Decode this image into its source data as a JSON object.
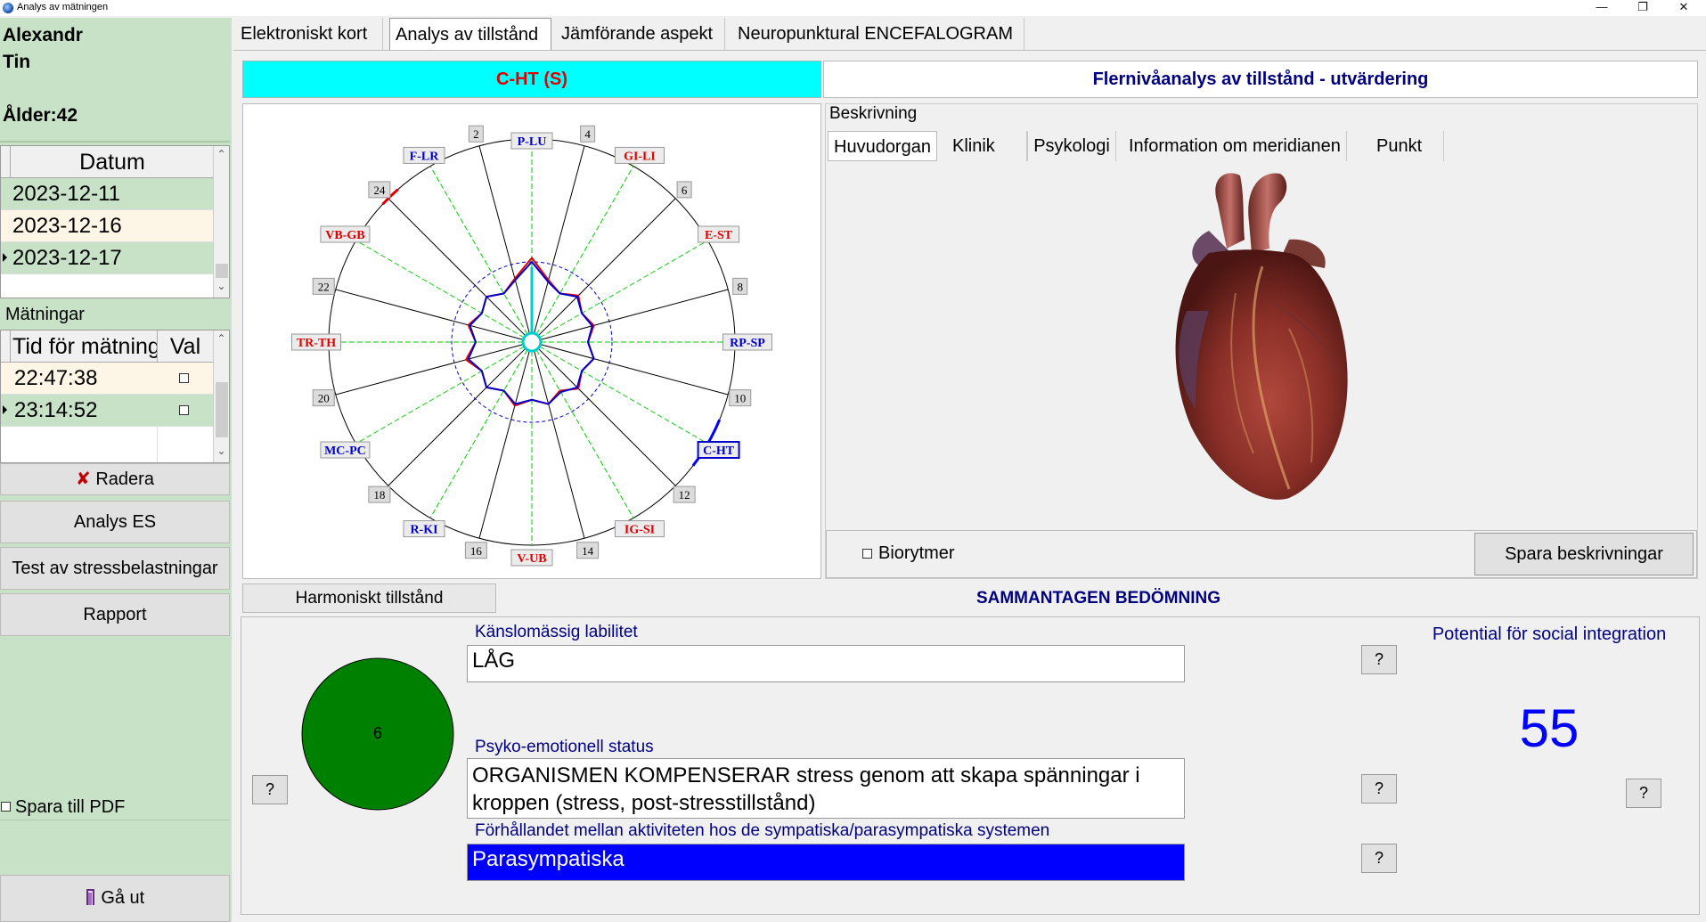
{
  "window": {
    "title": "Analys av mätningen",
    "controls": {
      "minimize": "—",
      "maximize": "❐",
      "close": "✕"
    }
  },
  "patient": {
    "first_name": "Alexandr",
    "last_name": "Tin",
    "age_label": "Ålder:42"
  },
  "dates": {
    "header": "Datum",
    "rows": [
      "2023-12-11",
      "2023-12-16",
      "2023-12-17"
    ]
  },
  "measurements": {
    "label": "Mätningar",
    "col_time": "Tid för mätning",
    "col_val": "Val",
    "rows": [
      "22:47:38",
      "23:14:52"
    ]
  },
  "sidebar_buttons": {
    "delete": "Radera",
    "delete_icon": "✘",
    "analysis": "Analys ES",
    "stress": "Test av stressbelastningar",
    "report": "Rapport",
    "save_pdf": "Spara till PDF",
    "exit": "Gå ut"
  },
  "tabs": [
    "Elektroniskt kort",
    "Analys av tillstånd",
    "Jämförande aspekt",
    "Neuropunktural ENCEFALOGRAM"
  ],
  "headers": {
    "cht": "C-HT (S)",
    "multilevel": "Flernivåanalys av tillstånd - utvärdering"
  },
  "radar": {
    "labels": [
      {
        "text": "P-LU",
        "color": "#0000cc"
      },
      {
        "text": "4"
      },
      {
        "text": "GI-LI",
        "color": "#e00000"
      },
      {
        "text": "6"
      },
      {
        "text": "E-ST",
        "color": "#e00000"
      },
      {
        "text": "8"
      },
      {
        "text": "RP-SP",
        "color": "#0000cc"
      },
      {
        "text": "10"
      },
      {
        "text": "C-HT",
        "color": "#0000cc"
      },
      {
        "text": "12"
      },
      {
        "text": "IG-SI",
        "color": "#e00000"
      },
      {
        "text": "14"
      },
      {
        "text": "V-UB",
        "color": "#e00000"
      },
      {
        "text": "16"
      },
      {
        "text": "R-KI",
        "color": "#0000cc"
      },
      {
        "text": "18"
      },
      {
        "text": "MC-PC",
        "color": "#0000cc"
      },
      {
        "text": "20"
      },
      {
        "text": "TR-TH",
        "color": "#e00000"
      },
      {
        "text": "22"
      },
      {
        "text": "VB-GB",
        "color": "#e00000"
      },
      {
        "text": "24"
      },
      {
        "text": "F-LR",
        "color": "#0000cc"
      },
      {
        "text": "2"
      }
    ],
    "red_series": [
      1.05,
      0.8,
      0.7,
      0.82,
      0.72,
      0.8,
      0.7,
      0.8,
      0.72,
      0.82,
      0.7,
      0.8,
      0.72,
      0.82,
      0.7,
      0.8,
      0.72,
      0.85,
      0.7,
      0.82,
      0.72,
      0.8,
      0.7,
      0.82
    ],
    "blue_series": [
      1.0,
      0.78,
      0.7,
      0.8,
      0.72,
      0.78,
      0.7,
      0.8,
      0.72,
      0.8,
      0.72,
      0.8,
      0.72,
      0.8,
      0.7,
      0.8,
      0.72,
      0.82,
      0.7,
      0.8,
      0.72,
      0.8,
      0.7,
      0.8
    ],
    "highlight_sector": "C-HT"
  },
  "description": {
    "label": "Beskrivning",
    "tabs": [
      "Huvudorgan",
      "Klinik",
      "Psykologi",
      "Information om meridianen",
      "Punkt"
    ],
    "biorhythm_label": "Biorytmer",
    "save_button": "Spara beskrivningar"
  },
  "assessment": {
    "harmonic_tab": "Harmoniskt tillstånd",
    "title": "SAMMANTAGEN BEDÖMNING",
    "circle_value": "6",
    "circle_color": "#008000",
    "emotional_lability_label": "Känslomässig labilitet",
    "emotional_lability_value": "LÅG",
    "psycho_status_label": "Psyko-emotionell status",
    "psycho_status_value": " ORGANISMEN KOMPENSERAR stress genom att skapa spänningar i kroppen (stress, post-stresstillstånd)",
    "balance_label": "Förhållandet mellan aktiviteten hos de sympatiska/parasympatiska systemen",
    "balance_value": "Parasympatiska",
    "social_label": "Potential för social integration",
    "social_value": "55",
    "help": "?"
  }
}
